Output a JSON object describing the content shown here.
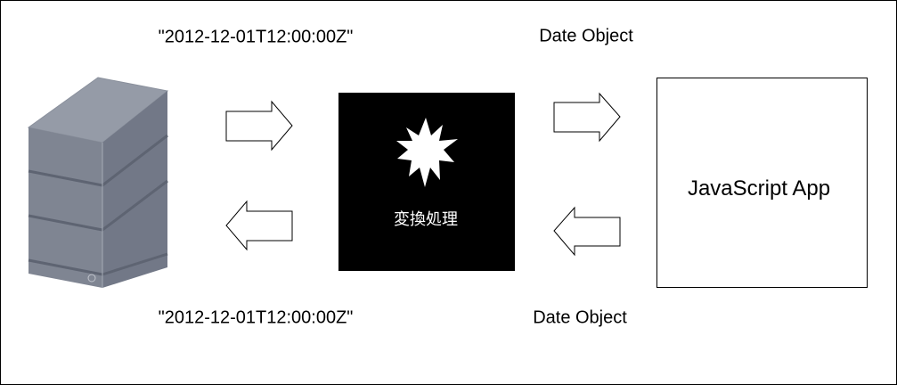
{
  "labels": {
    "top_left": "\"2012-12-01T12:00:00Z\"",
    "top_right": "Date Object",
    "bottom_left": "\"2012-12-01T12:00:00Z\"",
    "bottom_right": "Date Object"
  },
  "converter": {
    "label": "変換処理"
  },
  "app": {
    "label": "JavaScript App"
  },
  "colors": {
    "server_front": "#7f8592",
    "server_side": "#6f7584",
    "server_top": "#949aa6",
    "converter_bg": "#000000"
  }
}
